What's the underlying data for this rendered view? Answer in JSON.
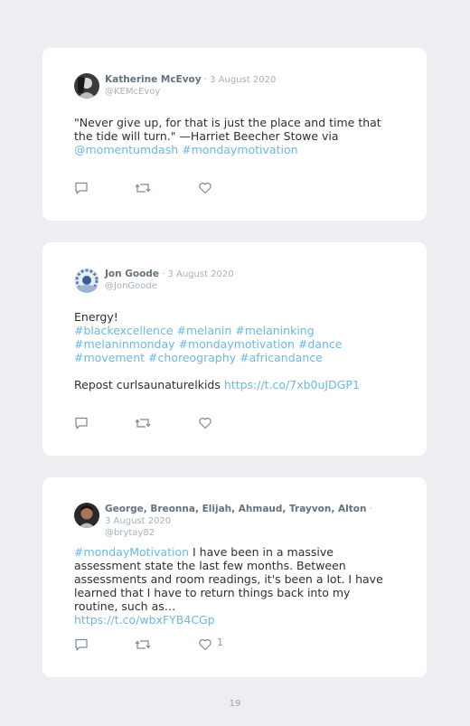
{
  "tweets": [
    {
      "name": "Katherine McEvoy",
      "date_sep": " · ",
      "date": "3 August 2020",
      "handle": "@KEMcEvoy",
      "text": "\"Never give up, for that is just the place and time that the tide will turn.\" —Harriet Beecher Stowe via",
      "links": "@momentumdash #mondaymotivation",
      "like_count": ""
    },
    {
      "name": "Jon Goode",
      "date_sep": " · ",
      "date": "3 August 2020",
      "handle": "@JonGoode",
      "line1": "Energy!",
      "hashtags": "#blackexcellence #melanin #melaninking #melaninmonday #mondaymotivation #dance #movement #choreography #africandance",
      "repost_text": "Repost curlsaunaturelkids ",
      "repost_link": "https://t.co/7xb0uJDGP1",
      "like_count": ""
    },
    {
      "name": "George, Breonna, Elijah, Ahmaud, Trayvon, Alton",
      "date_sep": " · ",
      "date": "3 August 2020",
      "handle": "@brytay82",
      "lead_hashtag": "#mondayMotivation",
      "text": " I have been in a massive assessment state the last few months. Between assessments and room readings, it's been a lot. I have learned that I have to return things back into my routine, such as…",
      "link": "https://t.co/wbxFYB4CGp",
      "like_count": "1"
    }
  ],
  "icons": {
    "reply": "reply-icon",
    "retweet": "retweet-icon",
    "like": "heart-icon"
  },
  "page_number": "19"
}
